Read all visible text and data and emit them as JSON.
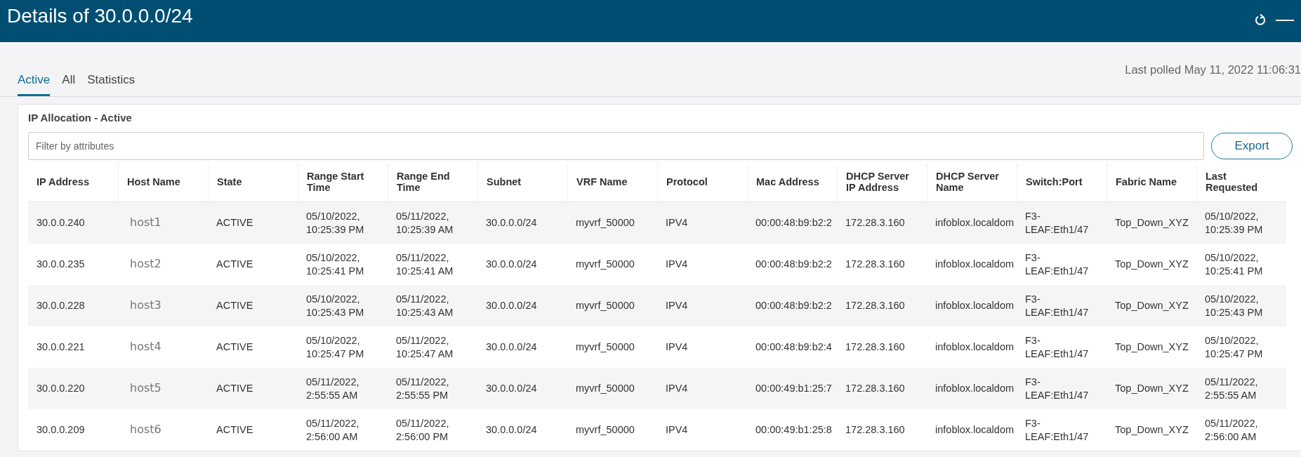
{
  "window": {
    "title": "Details of 30.0.0.0/24"
  },
  "tabs": [
    {
      "label": "Active",
      "selected": true
    },
    {
      "label": "All",
      "selected": false
    },
    {
      "label": "Statistics",
      "selected": false
    }
  ],
  "last_polled": "Last polled May 11, 2022 11:06:31",
  "panel": {
    "title": "IP Allocation - Active",
    "filter": {
      "placeholder": "Filter by attributes"
    },
    "export_button": "Export"
  },
  "table": {
    "columns": [
      "IP Address",
      "Host Name",
      "State",
      "Range Start Time",
      "Range End Time",
      "Subnet",
      "VRF Name",
      "Protocol",
      "Mac Address",
      "DHCP Server IP Address",
      "DHCP Server Name",
      "Switch:Port",
      "Fabric Name",
      "Last Requested"
    ],
    "rows": [
      [
        "30.0.0.240",
        "host1",
        "ACTIVE",
        "05/10/2022, 10:25:39 PM",
        "05/11/2022, 10:25:39 AM",
        "30.0.0.0/24",
        "myvrf_50000",
        "IPV4",
        "00:00:48:b9:b2:2",
        "172.28.3.160",
        "infoblox.localdom",
        "F3-LEAF:Eth1/47",
        "Top_Down_XYZ",
        "05/10/2022, 10:25:39 PM"
      ],
      [
        "30.0.0.235",
        "host2",
        "ACTIVE",
        "05/10/2022, 10:25:41 PM",
        "05/11/2022, 10:25:41 AM",
        "30.0.0.0/24",
        "myvrf_50000",
        "IPV4",
        "00:00:48:b9:b2:2",
        "172.28.3.160",
        "infoblox.localdom",
        "F3-LEAF:Eth1/47",
        "Top_Down_XYZ",
        "05/10/2022, 10:25:41 PM"
      ],
      [
        "30.0.0.228",
        "host3",
        "ACTIVE",
        "05/10/2022, 10:25:43 PM",
        "05/11/2022, 10:25:43 AM",
        "30.0.0.0/24",
        "myvrf_50000",
        "IPV4",
        "00:00:48:b9:b2:2",
        "172.28.3.160",
        "infoblox.localdom",
        "F3-LEAF:Eth1/47",
        "Top_Down_XYZ",
        "05/10/2022, 10:25:43 PM"
      ],
      [
        "30.0.0.221",
        "host4",
        "ACTIVE",
        "05/10/2022, 10:25:47 PM",
        "05/11/2022, 10:25:47 AM",
        "30.0.0.0/24",
        "myvrf_50000",
        "IPV4",
        "00:00:48:b9:b2:4",
        "172.28.3.160",
        "infoblox.localdom",
        "F3-LEAF:Eth1/47",
        "Top_Down_XYZ",
        "05/10/2022, 10:25:47 PM"
      ],
      [
        "30.0.0.220",
        "host5",
        "ACTIVE",
        "05/11/2022, 2:55:55 AM",
        "05/11/2022, 2:55:55 PM",
        "30.0.0.0/24",
        "myvrf_50000",
        "IPV4",
        "00:00:49:b1:25:7",
        "172.28.3.160",
        "infoblox.localdom",
        "F3-LEAF:Eth1/47",
        "Top_Down_XYZ",
        "05/11/2022, 2:55:55 AM"
      ],
      [
        "30.0.0.209",
        "host6",
        "ACTIVE",
        "05/11/2022, 2:56:00 AM",
        "05/11/2022, 2:56:00 PM",
        "30.0.0.0/24",
        "myvrf_50000",
        "IPV4",
        "00:00:49:b1:25:8",
        "172.28.3.160",
        "infoblox.localdom",
        "F3-LEAF:Eth1/47",
        "Top_Down_XYZ",
        "05/11/2022, 2:56:00 AM"
      ]
    ]
  }
}
